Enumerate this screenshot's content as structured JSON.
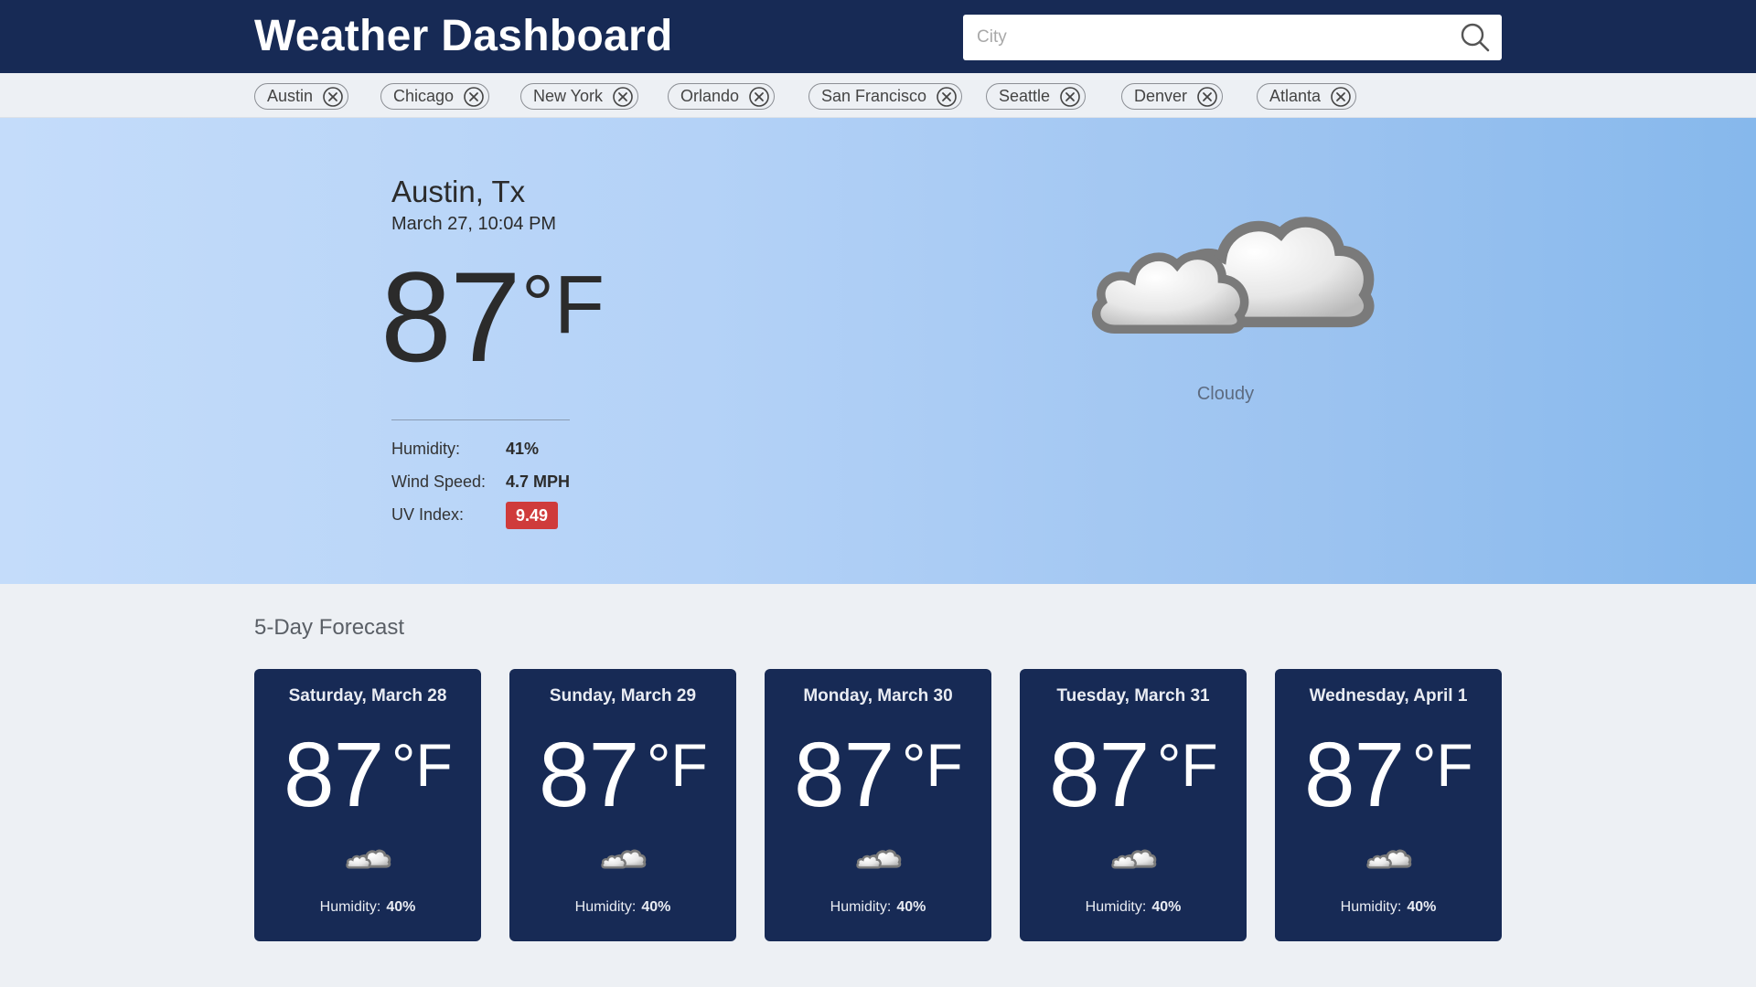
{
  "header": {
    "title": "Weather Dashboard",
    "search": {
      "placeholder": "City",
      "value": "",
      "icon": "search-icon"
    }
  },
  "cities": [
    {
      "label": "Austin",
      "icon": "close-circle-icon"
    },
    {
      "label": "Chicago",
      "icon": "close-circle-icon"
    },
    {
      "label": "New York",
      "icon": "close-circle-icon"
    },
    {
      "label": "Orlando",
      "icon": "close-circle-icon"
    },
    {
      "label": "San Francisco",
      "icon": "close-circle-icon"
    },
    {
      "label": "Seattle",
      "icon": "close-circle-icon"
    },
    {
      "label": "Denver",
      "icon": "close-circle-icon"
    },
    {
      "label": "Atlanta",
      "icon": "close-circle-icon"
    }
  ],
  "current": {
    "location": "Austin, Tx",
    "datetime": "March 27, 10:04 PM",
    "temperature": "87",
    "unit": "°F",
    "condition": "Cloudy",
    "icon": "cloudy-icon",
    "humidity_label": "Humidity:",
    "humidity": "41%",
    "wind_label": "Wind Speed:",
    "wind": "4.7 MPH",
    "uv_label": "UV Index:",
    "uv": "9.49",
    "uv_color": "#cf3b3b"
  },
  "forecast": {
    "title": "5-Day Forecast",
    "days": [
      {
        "day": "Saturday, March 28",
        "temp": "87",
        "unit": "°F",
        "icon": "cloudy-icon",
        "humidity_label": "Humidity:",
        "humidity": "40%"
      },
      {
        "day": "Sunday, March 29",
        "temp": "87",
        "unit": "°F",
        "icon": "cloudy-icon",
        "humidity_label": "Humidity:",
        "humidity": "40%"
      },
      {
        "day": "Monday, March 30",
        "temp": "87",
        "unit": "°F",
        "icon": "cloudy-icon",
        "humidity_label": "Humidity:",
        "humidity": "40%"
      },
      {
        "day": "Tuesday, March 31",
        "temp": "87",
        "unit": "°F",
        "icon": "cloudy-icon",
        "humidity_label": "Humidity:",
        "humidity": "40%"
      },
      {
        "day": "Wednesday, April 1",
        "temp": "87",
        "unit": "°F",
        "icon": "cloudy-icon",
        "humidity_label": "Humidity:",
        "humidity": "40%"
      }
    ]
  },
  "colors": {
    "header_bg": "#172a55",
    "card_bg": "#172a55",
    "page_bg": "#edf0f4",
    "hero_gradient_start": "#c4dcfa",
    "hero_gradient_end": "#86b8ec"
  }
}
